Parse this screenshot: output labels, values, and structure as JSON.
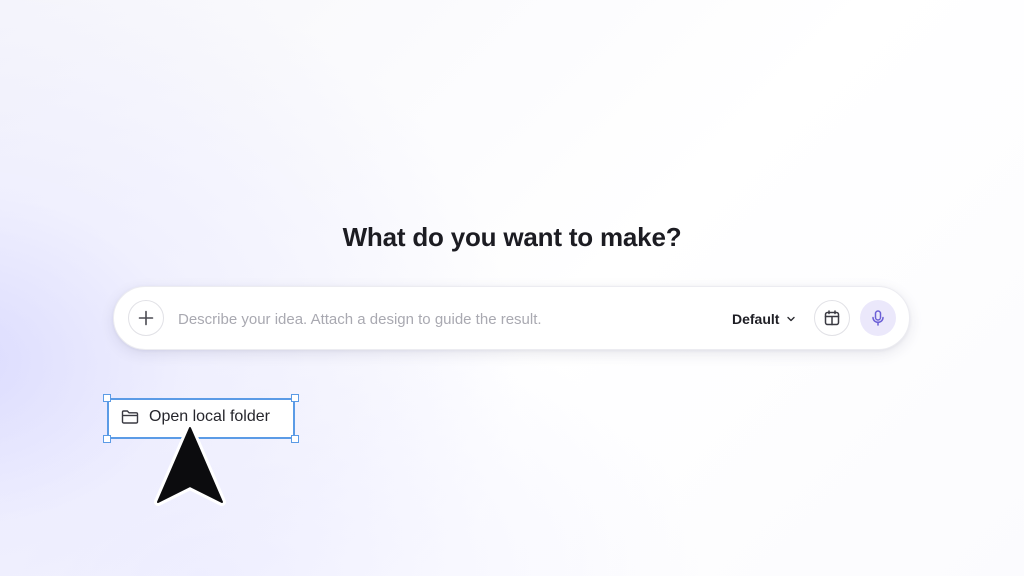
{
  "heading": "What do you want to make?",
  "prompt_bar": {
    "add_icon": "plus-icon",
    "placeholder": "Describe your idea. Attach a design to guide the result.",
    "value": "",
    "model_select": {
      "selected": "Default",
      "chevron_icon": "chevron-down-icon"
    },
    "calendar_icon": "calendar-icon",
    "mic_icon": "microphone-icon"
  },
  "open_folder": {
    "label": "Open local folder",
    "icon": "folder-icon"
  },
  "cursor_icon": "arrow-cursor-icon",
  "colors": {
    "accent": "#6b5fd6",
    "mic_bg": "#ebe8fb",
    "selection": "#5b9be6",
    "text": "#1c1c22",
    "placeholder": "#a9a9b1"
  }
}
